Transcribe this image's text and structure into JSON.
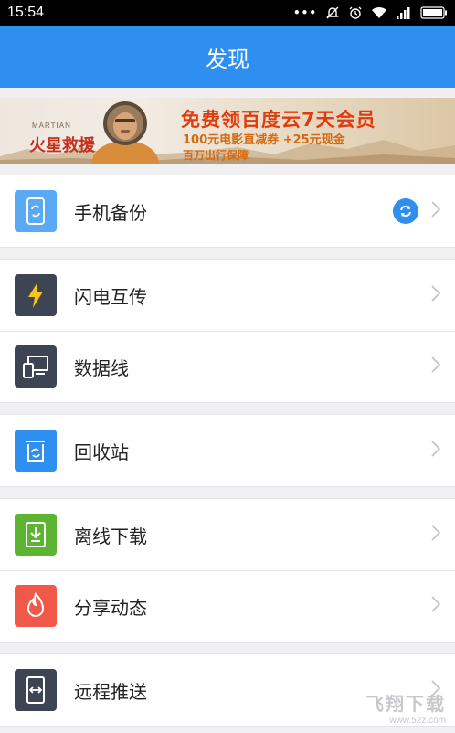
{
  "status_bar": {
    "time": "15:54",
    "dots": "•••"
  },
  "header": {
    "title": "发现"
  },
  "banner": {
    "brand_small": "MARTIAN",
    "brand": "火星救援",
    "headline": "免费领百度云7天会员",
    "line2": "100元电影直减券 +25元现金",
    "line3": "百万出行保障"
  },
  "groups": [
    {
      "items": [
        {
          "label": "手机备份",
          "icon": "phone-sync-icon",
          "color": "#5aa9f5",
          "badge": "sync-icon"
        }
      ]
    },
    {
      "items": [
        {
          "label": "闪电互传",
          "icon": "lightning-icon",
          "color": "#3d4454"
        },
        {
          "label": "数据线",
          "icon": "devices-icon",
          "color": "#3d4454"
        }
      ]
    },
    {
      "items": [
        {
          "label": "回收站",
          "icon": "recycle-bin-icon",
          "color": "#2f8ff0"
        }
      ]
    },
    {
      "items": [
        {
          "label": "离线下载",
          "icon": "download-icon",
          "color": "#5cb531"
        },
        {
          "label": "分享动态",
          "icon": "flame-icon",
          "color": "#f0584a"
        }
      ]
    },
    {
      "items": [
        {
          "label": "远程推送",
          "icon": "remote-push-icon",
          "color": "#3d4454"
        }
      ]
    }
  ],
  "watermark": {
    "text": "飞翔下载",
    "url": "www.52z.com"
  }
}
